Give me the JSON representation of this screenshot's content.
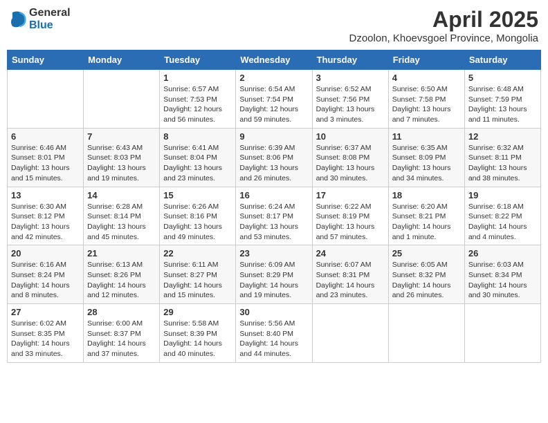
{
  "logo": {
    "general": "General",
    "blue": "Blue"
  },
  "header": {
    "month": "April 2025",
    "location": "Dzoolon, Khoevsgoel Province, Mongolia"
  },
  "weekdays": [
    "Sunday",
    "Monday",
    "Tuesday",
    "Wednesday",
    "Thursday",
    "Friday",
    "Saturday"
  ],
  "weeks": [
    [
      {
        "day": "",
        "info": ""
      },
      {
        "day": "",
        "info": ""
      },
      {
        "day": "1",
        "info": "Sunrise: 6:57 AM\nSunset: 7:53 PM\nDaylight: 12 hours\nand 56 minutes."
      },
      {
        "day": "2",
        "info": "Sunrise: 6:54 AM\nSunset: 7:54 PM\nDaylight: 12 hours\nand 59 minutes."
      },
      {
        "day": "3",
        "info": "Sunrise: 6:52 AM\nSunset: 7:56 PM\nDaylight: 13 hours\nand 3 minutes."
      },
      {
        "day": "4",
        "info": "Sunrise: 6:50 AM\nSunset: 7:58 PM\nDaylight: 13 hours\nand 7 minutes."
      },
      {
        "day": "5",
        "info": "Sunrise: 6:48 AM\nSunset: 7:59 PM\nDaylight: 13 hours\nand 11 minutes."
      }
    ],
    [
      {
        "day": "6",
        "info": "Sunrise: 6:46 AM\nSunset: 8:01 PM\nDaylight: 13 hours\nand 15 minutes."
      },
      {
        "day": "7",
        "info": "Sunrise: 6:43 AM\nSunset: 8:03 PM\nDaylight: 13 hours\nand 19 minutes."
      },
      {
        "day": "8",
        "info": "Sunrise: 6:41 AM\nSunset: 8:04 PM\nDaylight: 13 hours\nand 23 minutes."
      },
      {
        "day": "9",
        "info": "Sunrise: 6:39 AM\nSunset: 8:06 PM\nDaylight: 13 hours\nand 26 minutes."
      },
      {
        "day": "10",
        "info": "Sunrise: 6:37 AM\nSunset: 8:08 PM\nDaylight: 13 hours\nand 30 minutes."
      },
      {
        "day": "11",
        "info": "Sunrise: 6:35 AM\nSunset: 8:09 PM\nDaylight: 13 hours\nand 34 minutes."
      },
      {
        "day": "12",
        "info": "Sunrise: 6:32 AM\nSunset: 8:11 PM\nDaylight: 13 hours\nand 38 minutes."
      }
    ],
    [
      {
        "day": "13",
        "info": "Sunrise: 6:30 AM\nSunset: 8:12 PM\nDaylight: 13 hours\nand 42 minutes."
      },
      {
        "day": "14",
        "info": "Sunrise: 6:28 AM\nSunset: 8:14 PM\nDaylight: 13 hours\nand 45 minutes."
      },
      {
        "day": "15",
        "info": "Sunrise: 6:26 AM\nSunset: 8:16 PM\nDaylight: 13 hours\nand 49 minutes."
      },
      {
        "day": "16",
        "info": "Sunrise: 6:24 AM\nSunset: 8:17 PM\nDaylight: 13 hours\nand 53 minutes."
      },
      {
        "day": "17",
        "info": "Sunrise: 6:22 AM\nSunset: 8:19 PM\nDaylight: 13 hours\nand 57 minutes."
      },
      {
        "day": "18",
        "info": "Sunrise: 6:20 AM\nSunset: 8:21 PM\nDaylight: 14 hours\nand 1 minute."
      },
      {
        "day": "19",
        "info": "Sunrise: 6:18 AM\nSunset: 8:22 PM\nDaylight: 14 hours\nand 4 minutes."
      }
    ],
    [
      {
        "day": "20",
        "info": "Sunrise: 6:16 AM\nSunset: 8:24 PM\nDaylight: 14 hours\nand 8 minutes."
      },
      {
        "day": "21",
        "info": "Sunrise: 6:13 AM\nSunset: 8:26 PM\nDaylight: 14 hours\nand 12 minutes."
      },
      {
        "day": "22",
        "info": "Sunrise: 6:11 AM\nSunset: 8:27 PM\nDaylight: 14 hours\nand 15 minutes."
      },
      {
        "day": "23",
        "info": "Sunrise: 6:09 AM\nSunset: 8:29 PM\nDaylight: 14 hours\nand 19 minutes."
      },
      {
        "day": "24",
        "info": "Sunrise: 6:07 AM\nSunset: 8:31 PM\nDaylight: 14 hours\nand 23 minutes."
      },
      {
        "day": "25",
        "info": "Sunrise: 6:05 AM\nSunset: 8:32 PM\nDaylight: 14 hours\nand 26 minutes."
      },
      {
        "day": "26",
        "info": "Sunrise: 6:03 AM\nSunset: 8:34 PM\nDaylight: 14 hours\nand 30 minutes."
      }
    ],
    [
      {
        "day": "27",
        "info": "Sunrise: 6:02 AM\nSunset: 8:35 PM\nDaylight: 14 hours\nand 33 minutes."
      },
      {
        "day": "28",
        "info": "Sunrise: 6:00 AM\nSunset: 8:37 PM\nDaylight: 14 hours\nand 37 minutes."
      },
      {
        "day": "29",
        "info": "Sunrise: 5:58 AM\nSunset: 8:39 PM\nDaylight: 14 hours\nand 40 minutes."
      },
      {
        "day": "30",
        "info": "Sunrise: 5:56 AM\nSunset: 8:40 PM\nDaylight: 14 hours\nand 44 minutes."
      },
      {
        "day": "",
        "info": ""
      },
      {
        "day": "",
        "info": ""
      },
      {
        "day": "",
        "info": ""
      }
    ]
  ]
}
